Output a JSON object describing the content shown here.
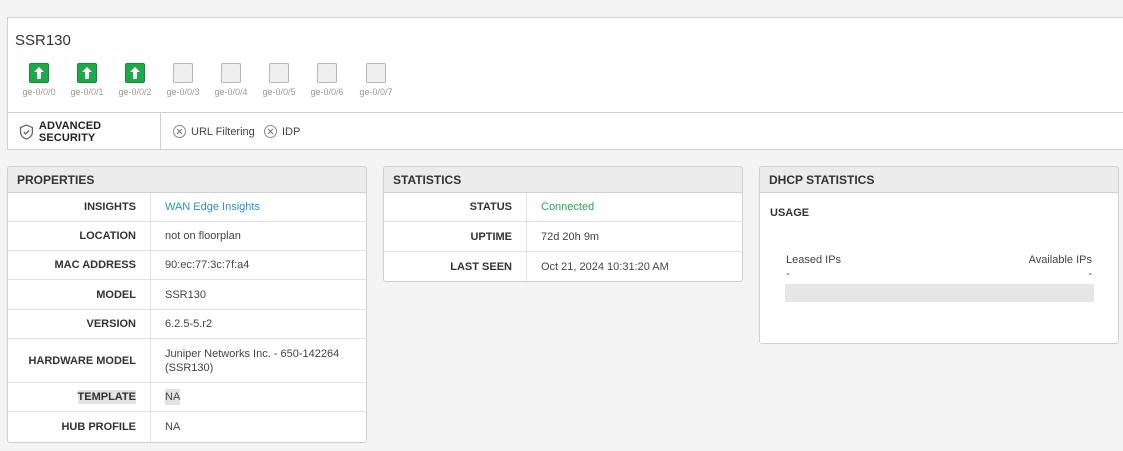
{
  "device": {
    "name": "SSR130",
    "ports": [
      {
        "label": "ge-0/0/0",
        "status": "up"
      },
      {
        "label": "ge-0/0/1",
        "status": "up"
      },
      {
        "label": "ge-0/0/2",
        "status": "up"
      },
      {
        "label": "ge-0/0/3",
        "status": "down"
      },
      {
        "label": "ge-0/0/4",
        "status": "down"
      },
      {
        "label": "ge-0/0/5",
        "status": "down"
      },
      {
        "label": "ge-0/0/6",
        "status": "down"
      },
      {
        "label": "ge-0/0/7",
        "status": "down"
      }
    ]
  },
  "security": {
    "title": "ADVANCED SECURITY",
    "items": [
      {
        "label": "URL Filtering"
      },
      {
        "label": "IDP"
      }
    ]
  },
  "properties": {
    "title": "PROPERTIES",
    "rows": [
      {
        "key": "INSIGHTS",
        "value": "WAN Edge Insights"
      },
      {
        "key": "LOCATION",
        "value": "not on floorplan"
      },
      {
        "key": "MAC ADDRESS",
        "value": "90:ec:77:3c:7f:a4"
      },
      {
        "key": "MODEL",
        "value": "SSR130"
      },
      {
        "key": "VERSION",
        "value": "6.2.5-5.r2"
      },
      {
        "key": "HARDWARE MODEL",
        "value": "Juniper Networks Inc. - 650-142264 (SSR130)"
      },
      {
        "key": "TEMPLATE",
        "value": "NA"
      },
      {
        "key": "HUB PROFILE",
        "value": "NA"
      }
    ]
  },
  "statistics": {
    "title": "STATISTICS",
    "rows": [
      {
        "key": "STATUS",
        "value": "Connected"
      },
      {
        "key": "UPTIME",
        "value": "72d 20h 9m"
      },
      {
        "key": "LAST SEEN",
        "value": "Oct 21, 2024 10:31:20 AM"
      }
    ]
  },
  "dhcp": {
    "title": "DHCP STATISTICS",
    "usage_label": "USAGE",
    "leased_label": "Leased IPs",
    "available_label": "Available IPs",
    "leased_value": "-",
    "available_value": "-"
  },
  "colors": {
    "port_up": "#1fa84b",
    "link": "#2a8fd6",
    "connected": "#1fa84b"
  }
}
